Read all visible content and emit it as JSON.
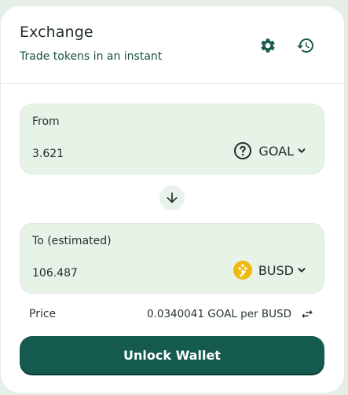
{
  "header": {
    "title": "Exchange",
    "subtitle": "Trade tokens in an instant",
    "settings_icon": "gear-icon",
    "history_icon": "history-icon"
  },
  "from": {
    "label": "From",
    "amount": "3.621",
    "token": "GOAL",
    "token_icon": "question-circle-icon"
  },
  "switch_icon": "arrow-down-icon",
  "to": {
    "label": "To (estimated)",
    "amount": "106.487",
    "token": "BUSD",
    "token_icon": "busd-logo"
  },
  "price": {
    "label": "Price",
    "value": "0.0340041 GOAL per BUSD",
    "swap_icon": "swap-arrows-icon"
  },
  "action": {
    "label": "Unlock Wallet"
  },
  "colors": {
    "page_background": "#e6efe7",
    "panel_background": "#e7f3e7",
    "primary": "#155a4f",
    "busd": "#f0b90b"
  }
}
